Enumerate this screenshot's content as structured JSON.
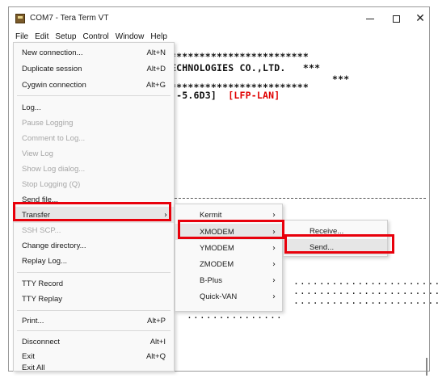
{
  "window": {
    "title": "COM7 - Tera Term VT",
    "controls": {
      "minimize": "",
      "maximize": "",
      "close": "✕"
    }
  },
  "menubar": {
    "items": [
      "File",
      "Edit",
      "Setup",
      "Control",
      "Window",
      "Help"
    ]
  },
  "terminal": {
    "stars_top": "************************",
    "company": "ECHNOLOGIES CO.,LTD.",
    "company_stars": "***",
    "stars_mid": "***",
    "stars_bottom": "************************",
    "version_prefix": "]-5.6D3]",
    "version_tag": "[LFP-LAN]",
    "dots_a": ".......................",
    "dots_b": ".......................",
    "dots_c": ".......................",
    "dots_d": "..............."
  },
  "file_menu": {
    "items": [
      {
        "label": "New connection...",
        "shortcut": "Alt+N",
        "enabled": true
      },
      {
        "label": "Duplicate session",
        "shortcut": "Alt+D",
        "enabled": true
      },
      {
        "label": "Cygwin connection",
        "shortcut": "Alt+G",
        "enabled": true
      },
      {
        "label": "Log...",
        "shortcut": "",
        "enabled": true
      },
      {
        "label": "Pause Logging",
        "shortcut": "",
        "enabled": false
      },
      {
        "label": "Comment to Log...",
        "shortcut": "",
        "enabled": false
      },
      {
        "label": "View Log",
        "shortcut": "",
        "enabled": false
      },
      {
        "label": "Show Log dialog...",
        "shortcut": "",
        "enabled": false
      },
      {
        "label": "Stop Logging (Q)",
        "shortcut": "",
        "enabled": false
      },
      {
        "label": "Send file...",
        "shortcut": "",
        "enabled": true
      },
      {
        "label": "Transfer",
        "shortcut": "",
        "enabled": true,
        "submenu": true
      },
      {
        "label": "SSH SCP...",
        "shortcut": "",
        "enabled": false
      },
      {
        "label": "Change directory...",
        "shortcut": "",
        "enabled": true
      },
      {
        "label": "Replay Log...",
        "shortcut": "",
        "enabled": true
      },
      {
        "label": "TTY Record",
        "shortcut": "",
        "enabled": true
      },
      {
        "label": "TTY Replay",
        "shortcut": "",
        "enabled": true
      },
      {
        "label": "Print...",
        "shortcut": "Alt+P",
        "enabled": true
      },
      {
        "label": "Disconnect",
        "shortcut": "Alt+I",
        "enabled": true
      },
      {
        "label": "Exit",
        "shortcut": "Alt+Q",
        "enabled": true
      },
      {
        "label": "Exit All",
        "shortcut": "",
        "enabled": true
      }
    ]
  },
  "transfer_menu": {
    "items": [
      "Kermit",
      "XMODEM",
      "YMODEM",
      "ZMODEM",
      "B-Plus",
      "Quick-VAN"
    ]
  },
  "xmodem_menu": {
    "items": [
      "Receive...",
      "Send..."
    ]
  },
  "colors": {
    "highlight_box": "#e8000b",
    "terminal_red": "#e00000"
  }
}
